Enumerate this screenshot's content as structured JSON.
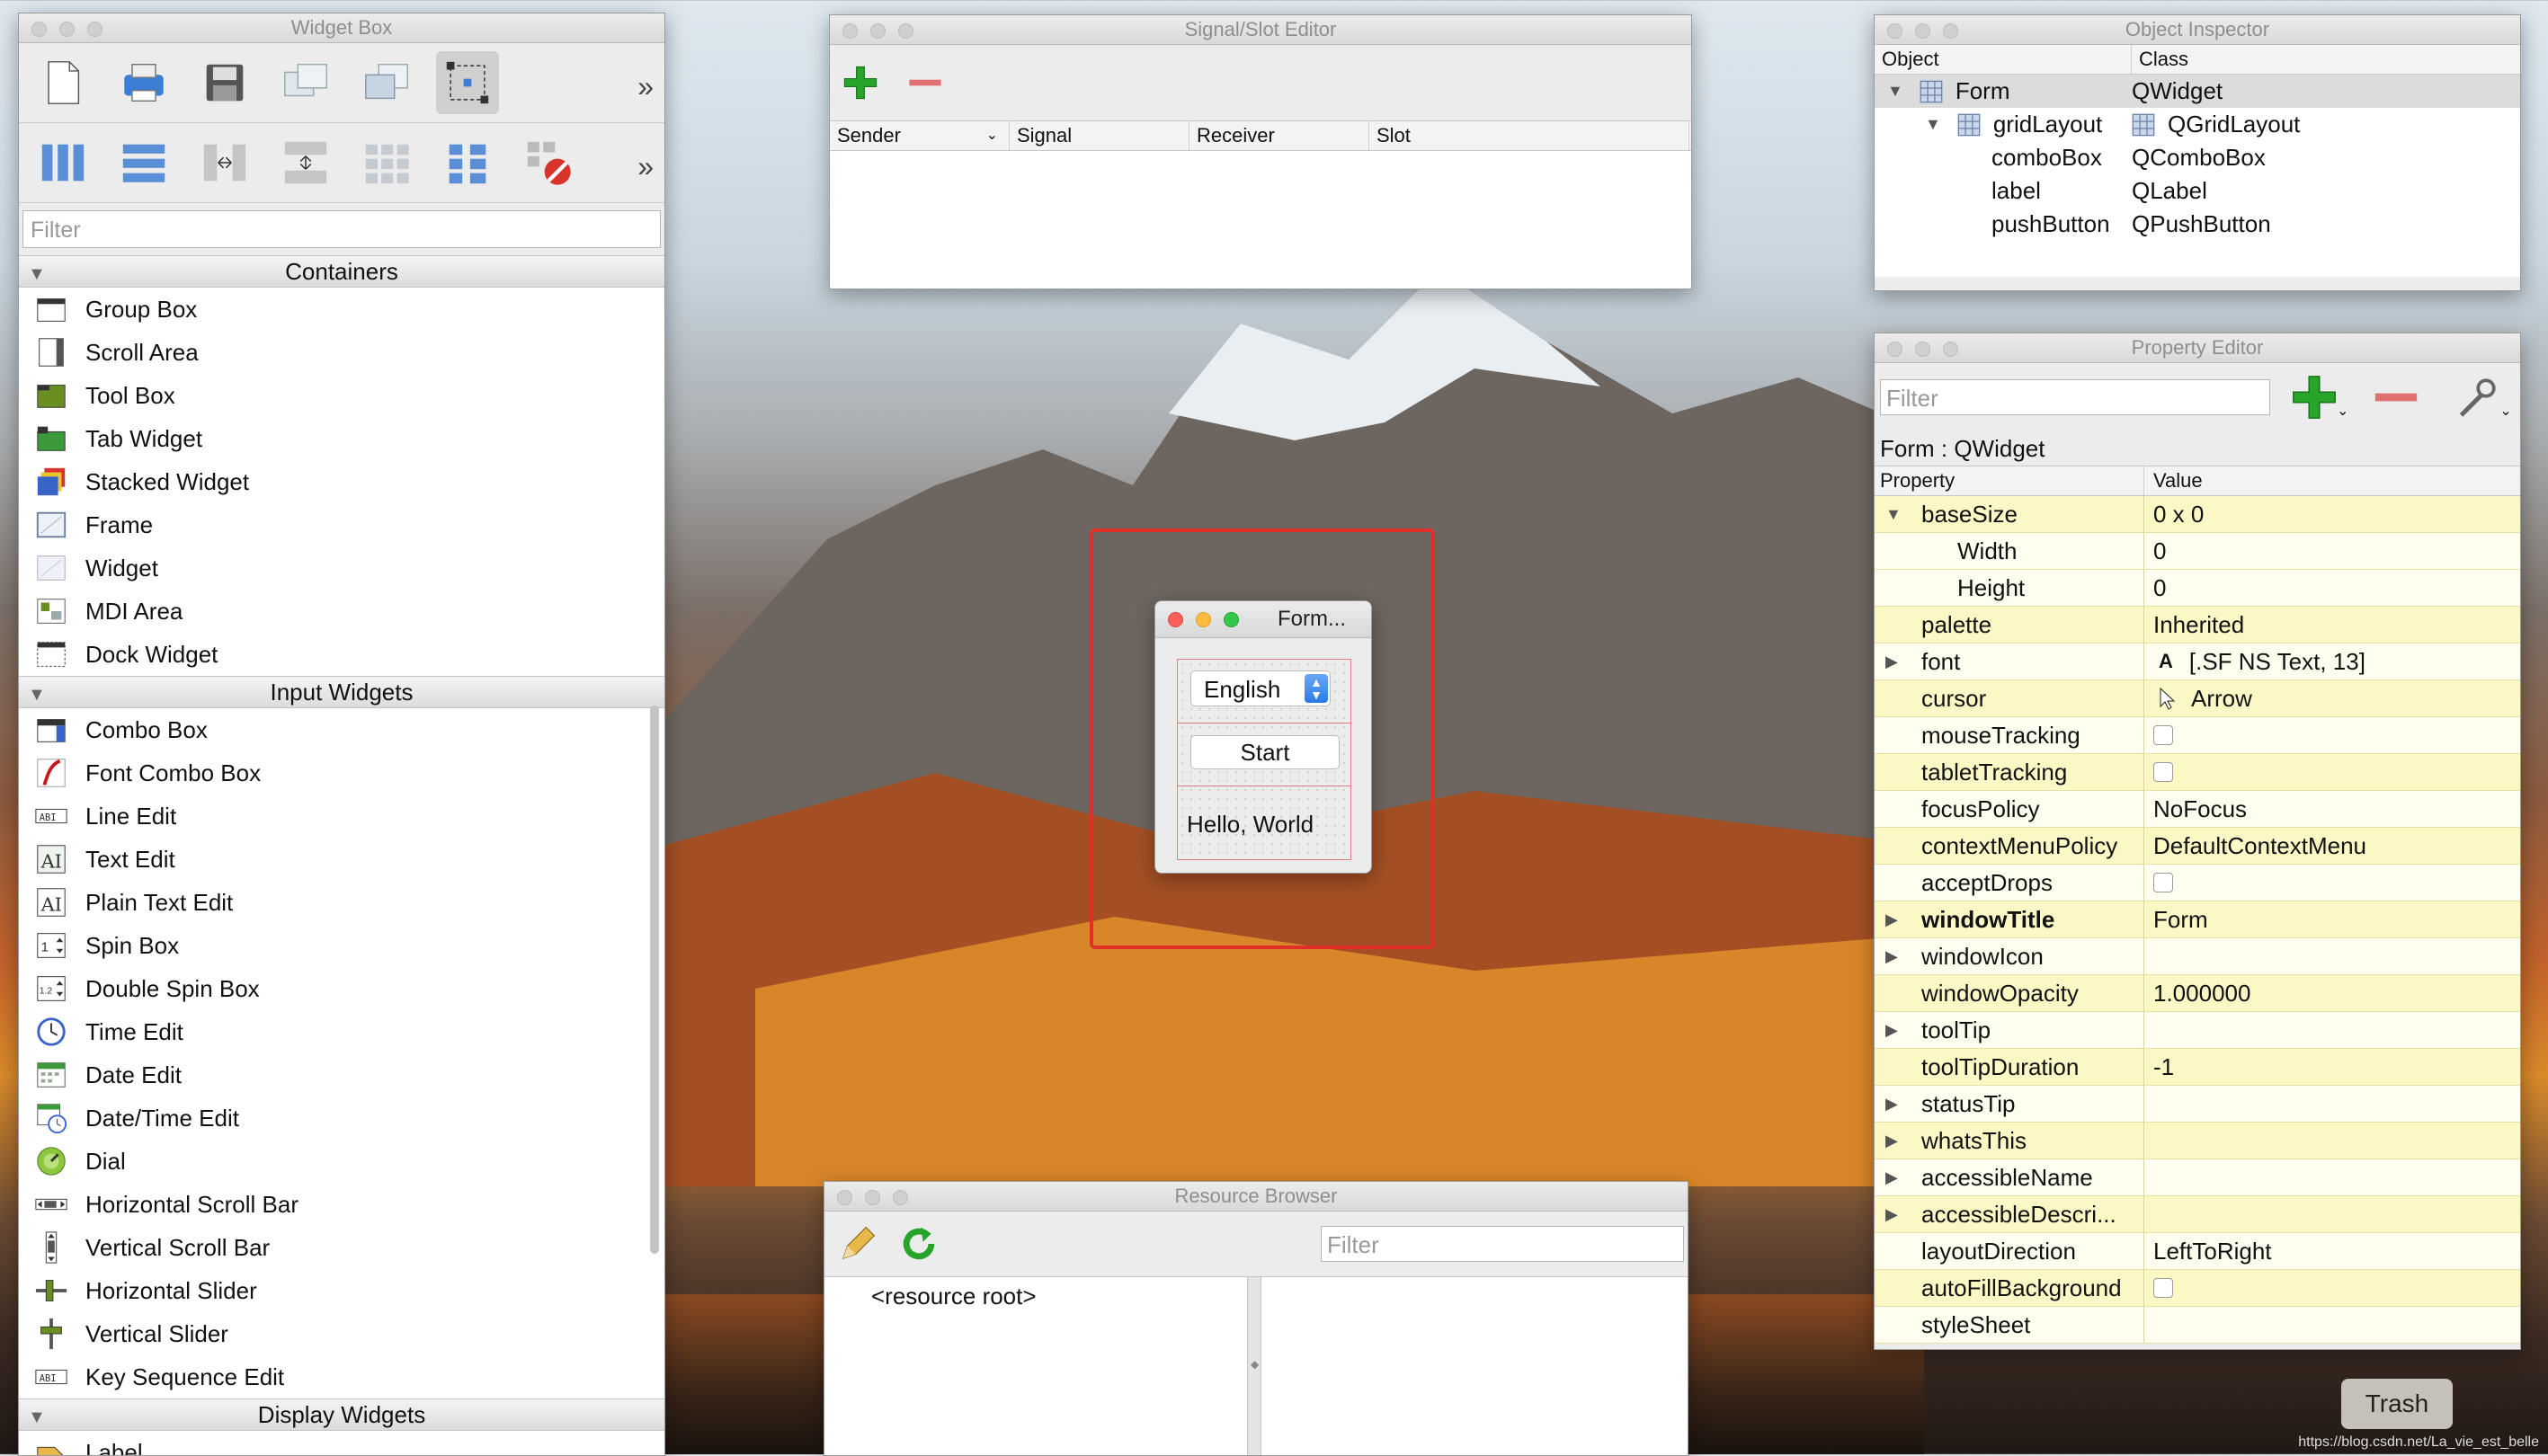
{
  "widget_box": {
    "title": "Widget Box",
    "filter_placeholder": "Filter",
    "sections": {
      "containers": {
        "label": "Containers",
        "items": [
          "Group Box",
          "Scroll Area",
          "Tool Box",
          "Tab Widget",
          "Stacked Widget",
          "Frame",
          "Widget",
          "MDI Area",
          "Dock Widget"
        ]
      },
      "input": {
        "label": "Input Widgets",
        "items": [
          "Combo Box",
          "Font Combo Box",
          "Line Edit",
          "Text Edit",
          "Plain Text Edit",
          "Spin Box",
          "Double Spin Box",
          "Time Edit",
          "Date Edit",
          "Date/Time Edit",
          "Dial",
          "Horizontal Scroll Bar",
          "Vertical Scroll Bar",
          "Horizontal Slider",
          "Vertical Slider",
          "Key Sequence Edit"
        ]
      },
      "display": {
        "label": "Display Widgets",
        "first_item": "Label"
      }
    }
  },
  "signal_slot": {
    "title": "Signal/Slot Editor",
    "columns": [
      "Sender",
      "Signal",
      "Receiver",
      "Slot"
    ]
  },
  "object_inspector": {
    "title": "Object Inspector",
    "col_object": "Object",
    "col_class": "Class",
    "rows": [
      {
        "object": "Form",
        "class": "QWidget"
      },
      {
        "object": "gridLayout",
        "class": "QGridLayout"
      },
      {
        "object": "comboBox",
        "class": "QComboBox"
      },
      {
        "object": "label",
        "class": "QLabel"
      },
      {
        "object": "pushButton",
        "class": "QPushButton"
      }
    ]
  },
  "property_editor": {
    "title": "Property Editor",
    "filter_placeholder": "Filter",
    "object_label": "Form : QWidget",
    "col_property": "Property",
    "col_value": "Value",
    "rows": [
      {
        "name": "baseSize",
        "value": "0 x 0"
      },
      {
        "name": "Width",
        "value": "0"
      },
      {
        "name": "Height",
        "value": "0"
      },
      {
        "name": "palette",
        "value": "Inherited"
      },
      {
        "name": "font",
        "value": "[.SF NS Text, 13]",
        "value_prefix": "A"
      },
      {
        "name": "cursor",
        "value": "Arrow"
      },
      {
        "name": "mouseTracking",
        "value": ""
      },
      {
        "name": "tabletTracking",
        "value": ""
      },
      {
        "name": "focusPolicy",
        "value": "NoFocus"
      },
      {
        "name": "contextMenuPolicy",
        "value": "DefaultContextMenu"
      },
      {
        "name": "acceptDrops",
        "value": ""
      },
      {
        "name": "windowTitle",
        "value": "Form"
      },
      {
        "name": "windowIcon",
        "value": ""
      },
      {
        "name": "windowOpacity",
        "value": "1.000000"
      },
      {
        "name": "toolTip",
        "value": ""
      },
      {
        "name": "toolTipDuration",
        "value": "-1"
      },
      {
        "name": "statusTip",
        "value": ""
      },
      {
        "name": "whatsThis",
        "value": ""
      },
      {
        "name": "accessibleName",
        "value": ""
      },
      {
        "name": "accessibleDescri...",
        "value": ""
      },
      {
        "name": "layoutDirection",
        "value": "LeftToRight"
      },
      {
        "name": "autoFillBackground",
        "value": ""
      },
      {
        "name": "styleSheet",
        "value": ""
      }
    ]
  },
  "resource_browser": {
    "title": "Resource Browser",
    "filter_placeholder": "Filter",
    "root": "<resource root>"
  },
  "form": {
    "title": "Form...",
    "combo_value": "English",
    "button_label": "Start",
    "label_text": "Hello, World"
  },
  "desktop": {
    "trash_label": "Trash",
    "watermark": "https://blog.csdn.net/La_vie_est_belle"
  },
  "colors": {
    "property_row": "#fbf8c5",
    "selection_outline": "#e0302a",
    "accent_green": "#27a52a",
    "accent_red": "#e07070"
  }
}
